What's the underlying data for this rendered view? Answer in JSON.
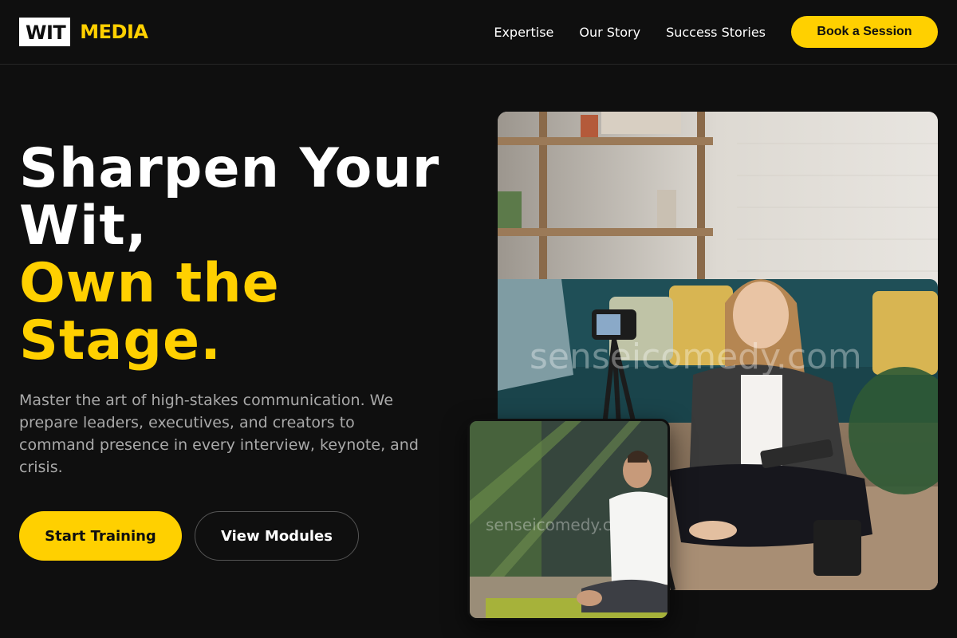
{
  "brand": {
    "logo_box_text": "WIT",
    "logo_text": "MEDIA",
    "accent_color": "#ffd000",
    "background_color": "#0f0f0f"
  },
  "nav": {
    "links": [
      "Expertise",
      "Our Story",
      "Success Stories"
    ],
    "cta_label": "Book a Session"
  },
  "hero": {
    "title_lines": [
      "Sharpen Your",
      "Wit,"
    ],
    "title_accent_lines": [
      "Own the",
      "Stage."
    ],
    "description": "Master the art of high-stakes communication. We prepare leaders, executives, and creators to command presence in every interview, keynote, and crisis.",
    "primary_button": "Start Training",
    "secondary_button": "View Modules"
  },
  "images": {
    "main_watermark": "senseicomedy.com",
    "inset_watermark": "senseicomedy.c"
  }
}
